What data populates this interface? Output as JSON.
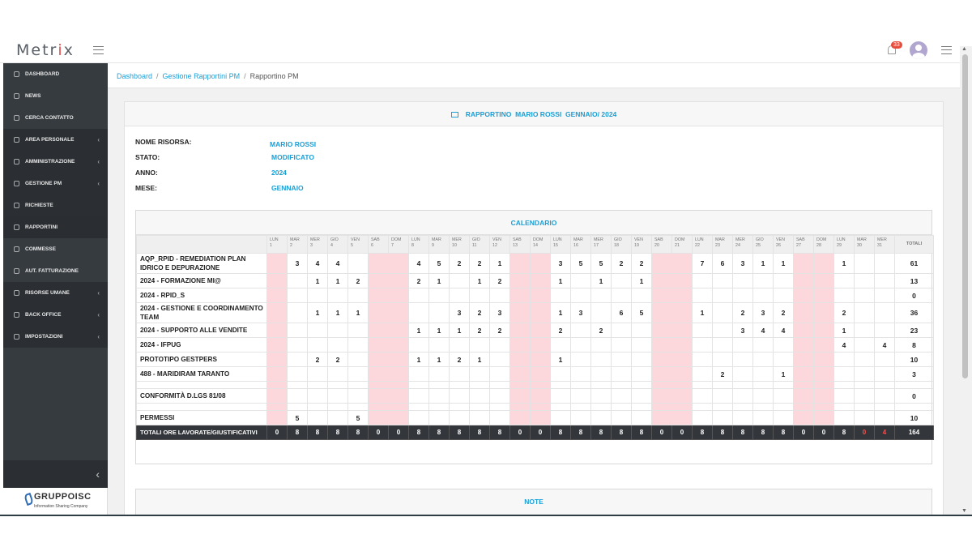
{
  "app": {
    "logo_pre": "Metr",
    "logo_i": "i",
    "logo_post": "x",
    "notification_count": "33"
  },
  "sidebar": {
    "items": [
      {
        "label": "Dashboard",
        "icon": "dashboard-icon",
        "chevron": false,
        "active": false
      },
      {
        "label": "News",
        "icon": "megaphone-icon",
        "chevron": false,
        "active": false
      },
      {
        "label": "Cerca contatto",
        "icon": "search-icon",
        "chevron": false,
        "active": false
      },
      {
        "label": "Area personale",
        "icon": "book-icon",
        "chevron": true,
        "active": false
      },
      {
        "label": "Amministrazione",
        "icon": "document-icon",
        "chevron": true,
        "active": false
      },
      {
        "label": "Gestione PM",
        "icon": "folder-icon",
        "chevron": true,
        "active": false
      },
      {
        "label": "Richieste",
        "icon": "list-icon",
        "chevron": false,
        "active": false,
        "sub": true
      },
      {
        "label": "Rapportini",
        "icon": "calendar-icon",
        "chevron": false,
        "active": true,
        "sub": true
      },
      {
        "label": "Commesse",
        "icon": "tag-icon",
        "chevron": false,
        "active": false
      },
      {
        "label": "Aut. fatturazione",
        "icon": "invoice-icon",
        "chevron": false,
        "active": false
      },
      {
        "label": "Risorse umane",
        "icon": "people-icon",
        "chevron": true,
        "active": false
      },
      {
        "label": "Back office",
        "icon": "briefcase-icon",
        "chevron": true,
        "active": false
      },
      {
        "label": "Impostazioni",
        "icon": "gear-icon",
        "chevron": true,
        "active": false
      }
    ],
    "collapse_glyph": "‹",
    "company": {
      "name": "GRUPPOISC",
      "tagline": "Information Sharing Company"
    }
  },
  "breadcrumb": {
    "items": [
      "Dashboard",
      "Gestione Rapportini PM"
    ],
    "current": "Rapportino PM"
  },
  "card": {
    "title": "RAPPORTINO  MARIO ROSSI  GENNAIO/ 2024"
  },
  "info": {
    "risorsa_label": "NOME RISORSA:",
    "risorsa_value": "MARIO ROSSI",
    "stato_label": "STATO:",
    "stato_value": "MODIFICATO",
    "anno_label": "ANNO:",
    "anno_value": "2024",
    "mese_label": "MESE:",
    "mese_value": "GENNAIO"
  },
  "calendar": {
    "title": "CALENDARIO",
    "totals_header": "TOTALI",
    "days": [
      [
        "LUN",
        "1"
      ],
      [
        "MAR",
        "2"
      ],
      [
        "MER",
        "3"
      ],
      [
        "GIO",
        "4"
      ],
      [
        "VEN",
        "5"
      ],
      [
        "SAB",
        "6"
      ],
      [
        "DOM",
        "7"
      ],
      [
        "LUN",
        "8"
      ],
      [
        "MAR",
        "9"
      ],
      [
        "MER",
        "10"
      ],
      [
        "GIO",
        "11"
      ],
      [
        "VEN",
        "12"
      ],
      [
        "SAB",
        "13"
      ],
      [
        "DOM",
        "14"
      ],
      [
        "LUN",
        "15"
      ],
      [
        "MAR",
        "16"
      ],
      [
        "MER",
        "17"
      ],
      [
        "GIO",
        "18"
      ],
      [
        "VEN",
        "19"
      ],
      [
        "SAB",
        "20"
      ],
      [
        "DOM",
        "21"
      ],
      [
        "LUN",
        "22"
      ],
      [
        "MAR",
        "23"
      ],
      [
        "MER",
        "24"
      ],
      [
        "GIO",
        "25"
      ],
      [
        "VEN",
        "26"
      ],
      [
        "SAB",
        "27"
      ],
      [
        "DOM",
        "28"
      ],
      [
        "LUN",
        "29"
      ],
      [
        "MAR",
        "30"
      ],
      [
        "MER",
        "31"
      ]
    ],
    "highlight_days": [
      1,
      6,
      7,
      13,
      14,
      20,
      21,
      27,
      28
    ],
    "rows": [
      {
        "activity": "AQP_RPID - REMEDIATION PLAN IDRICO E DEPURAZIONE",
        "cells": {
          "2": "3",
          "3": "4",
          "4": "4",
          "8": "4",
          "9": "5",
          "10": "2",
          "11": "2",
          "12": "1",
          "15": "3",
          "16": "5",
          "17": "5",
          "18": "2",
          "19": "2",
          "22": "7",
          "23": "6",
          "24": "3",
          "25": "1",
          "26": "1",
          "29": "1"
        },
        "total": "61",
        "gap_before": false
      },
      {
        "activity": "2024 - FORMAZIONE MI@",
        "cells": {
          "3": "1",
          "4": "1",
          "5": "2",
          "8": "2",
          "9": "1",
          "11": "1",
          "12": "2",
          "15": "1",
          "17": "1",
          "19": "1"
        },
        "total": "13",
        "gap_before": false
      },
      {
        "activity": "2024 - RPID_S",
        "cells": {},
        "total": "0",
        "gap_before": false
      },
      {
        "activity": "2024 - GESTIONE E COORDINAMENTO TEAM",
        "cells": {
          "3": "1",
          "4": "1",
          "5": "1",
          "10": "3",
          "11": "2",
          "12": "3",
          "15": "1",
          "16": "3",
          "18": "6",
          "19": "5",
          "22": "1",
          "24": "2",
          "25": "3",
          "26": "2",
          "29": "2"
        },
        "total": "36",
        "gap_before": false
      },
      {
        "activity": "2024 - SUPPORTO ALLE VENDITE",
        "cells": {
          "8": "1",
          "9": "1",
          "10": "1",
          "11": "2",
          "12": "2",
          "15": "2",
          "17": "2",
          "24": "3",
          "25": "4",
          "26": "4",
          "29": "1"
        },
        "total": "23",
        "gap_before": false
      },
      {
        "activity": "2024 - IFPUG",
        "cells": {
          "29": "4",
          "31": "4"
        },
        "total": "8",
        "gap_before": false
      },
      {
        "activity": "PROTOTIPO GESTPERS",
        "cells": {
          "3": "2",
          "4": "2",
          "8": "1",
          "9": "1",
          "10": "2",
          "11": "1",
          "15": "1"
        },
        "total": "10",
        "gap_before": false
      },
      {
        "activity": "488 - MARIDIRAM TARANTO",
        "cells": {
          "23": "2",
          "26": "1"
        },
        "total": "3",
        "gap_before": false
      },
      {
        "activity": "CONFORMITÀ D.LGS 81/08",
        "cells": {},
        "total": "0",
        "gap_before": true
      },
      {
        "activity": "PERMESSI",
        "cells": {
          "2": "5",
          "5": "5"
        },
        "total": "10",
        "gap_before": true
      }
    ],
    "totals_row": {
      "label": "TOTALI ORE LAVORATE/GIUSTIFICATIVI",
      "values": [
        "0",
        "8",
        "8",
        "8",
        "8",
        "0",
        "0",
        "8",
        "8",
        "8",
        "8",
        "8",
        "0",
        "0",
        "8",
        "8",
        "8",
        "8",
        "8",
        "0",
        "0",
        "8",
        "8",
        "8",
        "8",
        "8",
        "0",
        "0",
        "8",
        "0",
        "4"
      ],
      "red_days": [
        30,
        31
      ],
      "total": "164"
    }
  },
  "note": {
    "title": "NOTE"
  }
}
